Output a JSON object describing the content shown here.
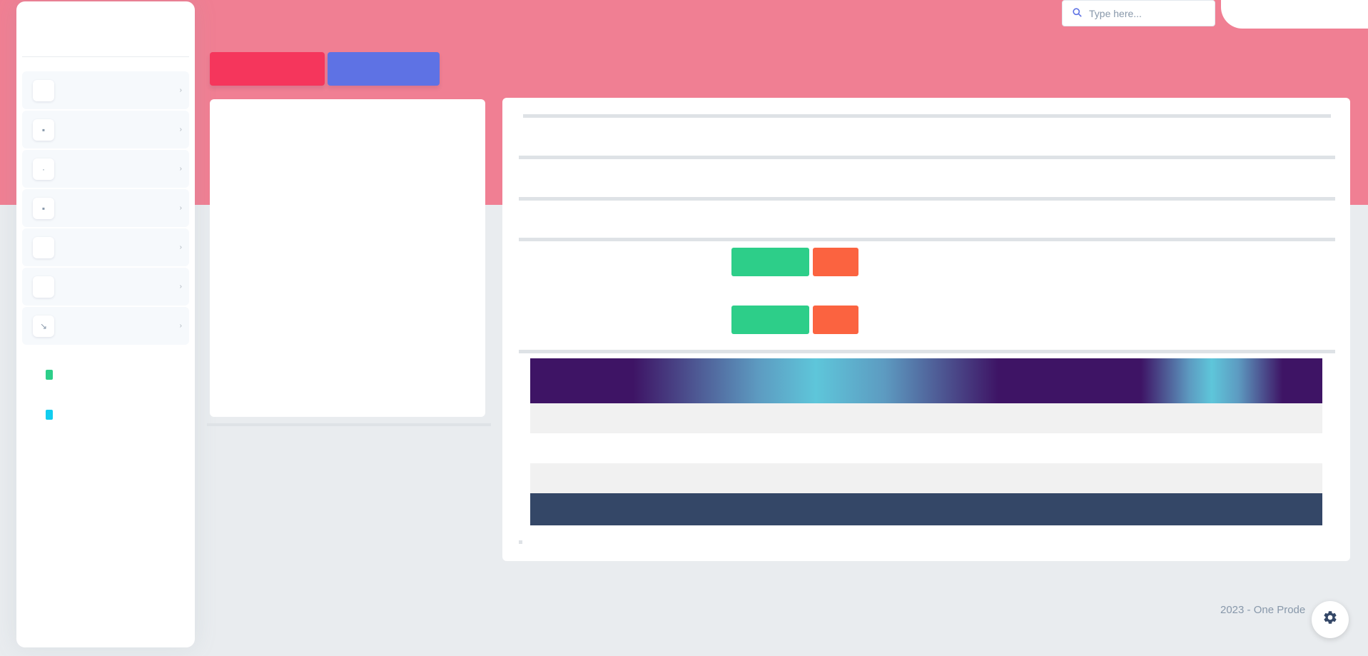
{
  "search": {
    "placeholder": "Type here..."
  },
  "sidebar": {
    "items": [
      {
        "label": "",
        "icon": "dashboard-icon"
      },
      {
        "label": "",
        "icon": "document-icon"
      },
      {
        "label": "",
        "icon": "box-icon"
      },
      {
        "label": "",
        "icon": "folder-icon"
      },
      {
        "label": "",
        "icon": "chart-icon"
      },
      {
        "label": "",
        "icon": "user-icon"
      },
      {
        "label": "",
        "icon": "settings-icon"
      }
    ],
    "section_heading": "",
    "plain_items": [
      {
        "label": "",
        "icon_color": "#2dce89"
      },
      {
        "label": "",
        "icon_color": "#11cdef"
      }
    ]
  },
  "actions": {
    "primary_danger": "",
    "primary_blue": ""
  },
  "details": {
    "rows": [
      {
        "label": "",
        "value": ""
      },
      {
        "label": "",
        "value": ""
      },
      {
        "label": "",
        "value": ""
      }
    ],
    "action_rows": [
      {
        "label": "",
        "approve": "",
        "reject": ""
      },
      {
        "label": "",
        "approve": "",
        "reject": ""
      }
    ]
  },
  "table": {
    "headers": [
      "",
      ""
    ],
    "rows": [
      [
        "",
        ""
      ],
      [
        "",
        ""
      ],
      [
        "",
        ""
      ]
    ],
    "total_label": "",
    "total_value": ""
  },
  "footer": {
    "text": "2023 - One Prode"
  },
  "colors": {
    "hero": "#f07f93",
    "danger": "#f5365c",
    "primary": "#5e72e4",
    "success": "#2dce89",
    "warning": "#fb6340",
    "table_footer": "#344767"
  }
}
